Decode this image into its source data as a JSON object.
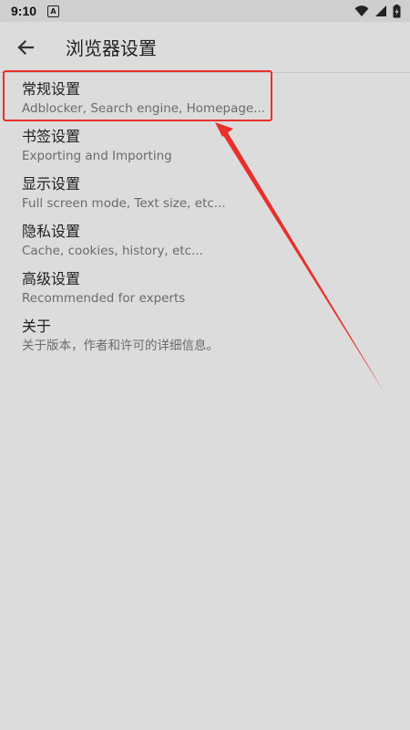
{
  "status_bar": {
    "time": "9:10",
    "notification_glyph": "A",
    "icons": [
      "wifi-icon",
      "signal-icon",
      "battery-icon"
    ]
  },
  "app_bar": {
    "title": "浏览器设置",
    "back_icon": "arrow-left-icon"
  },
  "settings": {
    "items": [
      {
        "title": "常规设置",
        "summary": "Adblocker, Search engine, Homepage..."
      },
      {
        "title": "书签设置",
        "summary": "Exporting and Importing"
      },
      {
        "title": "显示设置",
        "summary": "Full screen mode, Text size, etc..."
      },
      {
        "title": "隐私设置",
        "summary": "Cache, cookies, history, etc..."
      },
      {
        "title": "高级设置",
        "summary": "Recommended for experts"
      },
      {
        "title": "关于",
        "summary": "关于版本，作者和许可的详细信息。"
      }
    ]
  },
  "annotation": {
    "highlight_color": "#e8302a"
  },
  "colors": {
    "background": "#dcdcdc",
    "status_bar": "#cfcfcf",
    "title_text": "#202020",
    "summary_text": "#6b6b6b"
  }
}
